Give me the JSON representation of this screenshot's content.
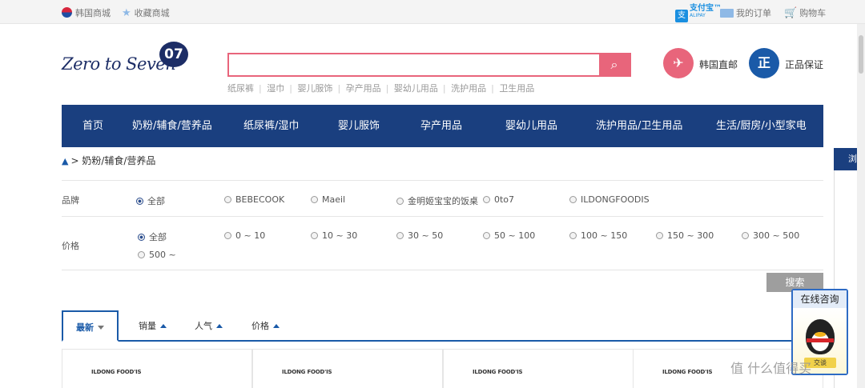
{
  "topbar": {
    "korea_mall": "韩国商城",
    "favorite_mall": "收藏商城",
    "alipay_brand": "支付宝™",
    "alipay_en": "ALIPAY",
    "my_orders": "我的订单",
    "cart": "购物车"
  },
  "logo": {
    "text": "Zero to Seven",
    "mark": "07"
  },
  "search": {
    "value": "",
    "placeholder": ""
  },
  "hotwords": [
    "纸尿裤",
    "湿巾",
    "婴儿服饰",
    "孕产用品",
    "婴幼儿用品",
    "洗护用品",
    "卫生用品"
  ],
  "badges": {
    "direct_mail": "韩国直邮",
    "genuine_mark": "正",
    "genuine": "正品保证"
  },
  "nav": {
    "items": [
      "首页",
      "奶粉/辅食/营养品",
      "纸尿裤/湿巾",
      "婴儿服饰",
      "孕产用品",
      "婴幼儿用品",
      "洗护用品/卫生用品",
      "生活/厨房/小型家电"
    ]
  },
  "breadcrumb": {
    "current": "> 奶粉/辅食/营养品"
  },
  "filters": {
    "brand_label": "品牌",
    "brands": [
      "全部",
      "BEBECOOK",
      "Maeil",
      "金明姬宝宝的饭桌",
      "0to7",
      "ILDONGFOODIS"
    ],
    "price_label": "价格",
    "prices": [
      "全部",
      "0 ~ 10",
      "10 ~ 30",
      "30 ~ 50",
      "50 ~ 100",
      "100 ~ 150",
      "150 ~ 300",
      "300 ~ 500",
      "500 ~"
    ],
    "search_button": "搜索"
  },
  "sort": {
    "tabs": [
      "最新",
      "销量",
      "人气",
      "价格"
    ]
  },
  "products": {
    "brands": [
      "ILDONG FOOD'IS",
      "ILDONG FOOD'IS",
      "ILDONG FOOD'IS",
      "ILDONG FOOD'IS"
    ]
  },
  "side": {
    "tab": "浏"
  },
  "qq": {
    "title": "在线咨询",
    "button": "交谈"
  },
  "watermark": "值 什么值得买",
  "colors": {
    "nav_bg": "#1a3f7f",
    "accent_pink": "#e8657b",
    "link_blue": "#1a5aa8"
  }
}
